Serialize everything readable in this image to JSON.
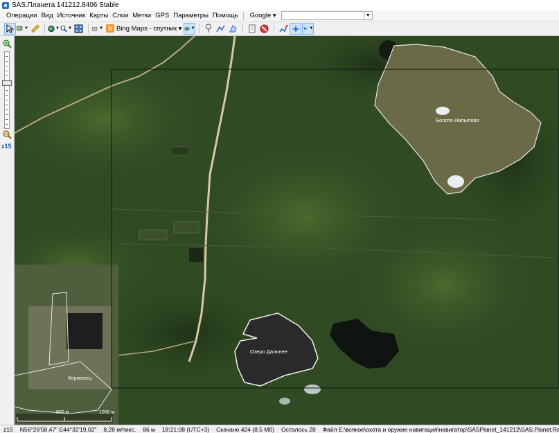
{
  "window": {
    "title": "SAS.Планета 141212.8406 Stable"
  },
  "menu": {
    "items": [
      "Операции",
      "Вид",
      "Источник",
      "Карты",
      "Слои",
      "Метки",
      "GPS",
      "Параметры",
      "Помощь"
    ],
    "search_engine": "Google ▾",
    "search_value": ""
  },
  "toolbar": {
    "map_source": "Bing Maps - спутник ▾",
    "bing_letter": "b"
  },
  "zoom": {
    "level": "z15"
  },
  "map": {
    "labels": {
      "bog": "Болото Напылово",
      "lake": "Озеро Дальнее",
      "town": "Керженец"
    },
    "scale": {
      "tick_500": "500 м",
      "tick_1000": "1000 м"
    }
  },
  "status": {
    "zoom": "z15",
    "coords": "N56°26'58,47\" E44°32'19,02\"",
    "resolution": "8,28 м/пикс.",
    "distance": "86 м",
    "time": "18:21:08 (UTC+3)",
    "downloaded": "Скачано 424 (8,5 Мб)",
    "remaining": "Осталось 28",
    "file": "Файл E:\\всякое\\охота и оружие навигация\\навигатор\\SASPlanet_141212\\SAS.Planet.Re"
  },
  "colors": {
    "forest": "#2f4a22",
    "bog": "#6b6a47",
    "lake": "#2a2a2a",
    "road": "#d8c9a0"
  }
}
